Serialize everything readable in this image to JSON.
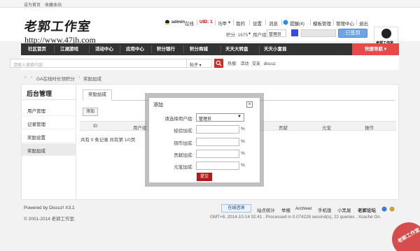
{
  "topbar": {
    "set_home": "设为首页",
    "bookmark": "收藏本站"
  },
  "header": {
    "logo": "老郭工作室",
    "url": "http://www.47jh.com",
    "user": {
      "name": "admin",
      "status": "在线",
      "uid": "UID: 1",
      "horse": "马甲",
      "mine": "我的",
      "settings": "设置",
      "messages": "消息",
      "remind": "提醒(4)",
      "template_manage": "模板管理",
      "manage_center": "管理中心",
      "logout": "退出",
      "points": "积分: 1675",
      "usergroup_label": "用户组:",
      "usergroup_value": "管理员",
      "signed": "已签到"
    },
    "avatar_text": "老郭工作室"
  },
  "nav": {
    "items": [
      "社区首页",
      "江湖游戏",
      "活动中心",
      "应用中心",
      "积分银行",
      "积分商城",
      "天天大转盘",
      "天天小富翁"
    ],
    "quick": "快捷导航"
  },
  "search": {
    "placeholder": "请输入搜索内容",
    "type": "帖子",
    "hot_label": "热搜:",
    "hot_items": [
      "活动",
      "交友",
      "discuz"
    ]
  },
  "breadcrumb": {
    "item1": "GA在线时长领积分",
    "item2": "奖励加成"
  },
  "sidebar": {
    "title": "后台管理",
    "items": [
      {
        "label": "用户管理"
      },
      {
        "label": "记录管理"
      },
      {
        "label": "奖励设置"
      },
      {
        "label": "奖励加成"
      }
    ]
  },
  "content": {
    "tab": "奖励加成",
    "add_button": "添加",
    "columns": [
      "ID",
      "用户组",
      "贡献",
      "元宝",
      "操作"
    ],
    "records": "共有 0 条记录 共有第 1/0页"
  },
  "dialog": {
    "title": "添加",
    "close": "×",
    "select_label": "请选择用户组:",
    "select_value": "管理员",
    "fields": [
      {
        "label": "经验加成:",
        "unit": "%"
      },
      {
        "label": "铜币加成:",
        "unit": "%"
      },
      {
        "label": "贡献加成:",
        "unit": "%"
      },
      {
        "label": "元宝加成:",
        "unit": "%"
      }
    ],
    "submit": "提交"
  },
  "footer": {
    "powered": "Powered by Discuz! X3.1",
    "copyright": "© 2001-2014 老郭工作室.",
    "online_service": "在线咨询",
    "links": [
      "站点统计",
      "举报",
      "Archiver",
      "手机版",
      "小黑屋",
      "老郭论坛"
    ],
    "info": "GMT+8, 2014-10-14 02:41 , Processed in 0.074228 second(s), 22 queries , Xcache On.",
    "stamp": "老郭工作室"
  },
  "colors": {
    "nav_bg": "#333333",
    "quick_nav": "#e84a4a",
    "submit": "#b01c1c",
    "signed": "#6aa6e8"
  }
}
